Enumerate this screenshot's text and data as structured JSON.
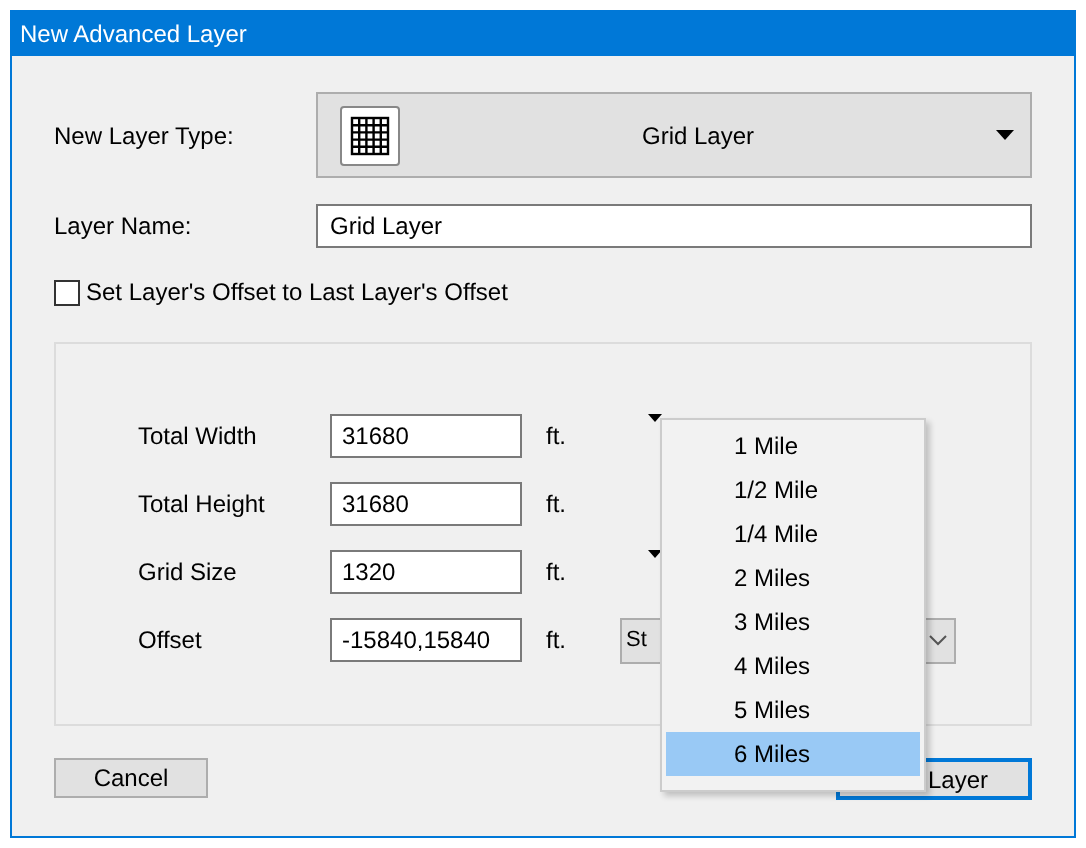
{
  "window": {
    "title": "New Advanced Layer"
  },
  "layer_type": {
    "label": "New Layer Type:",
    "value": "Grid Layer"
  },
  "layer_name": {
    "label": "Layer Name:",
    "value": "Grid Layer"
  },
  "offset_checkbox": {
    "label": "Set Layer's Offset to Last Layer's Offset",
    "checked": false
  },
  "rows": [
    {
      "label": "Total Width",
      "value": "31680",
      "unit": "ft.",
      "extra": {
        "kind": "arrow"
      }
    },
    {
      "label": "Total Height",
      "value": "31680",
      "unit": "ft."
    },
    {
      "label": "Grid Size",
      "value": "1320",
      "unit": "ft.",
      "extra": {
        "kind": "arrow"
      }
    },
    {
      "label": "Offset",
      "value": "-15840,15840",
      "unit": "ft.",
      "extra": {
        "kind": "combo",
        "text": "St"
      }
    }
  ],
  "buttons": {
    "cancel": "Cancel",
    "add": "Layer"
  },
  "size_menu": [
    {
      "label": "1 Mile",
      "selected": false
    },
    {
      "label": "1/2 Mile",
      "selected": false
    },
    {
      "label": "1/4 Mile",
      "selected": false
    },
    {
      "label": "2 Miles",
      "selected": false
    },
    {
      "label": "3 Miles",
      "selected": false
    },
    {
      "label": "4 Miles",
      "selected": false
    },
    {
      "label": "5 Miles",
      "selected": false
    },
    {
      "label": "6 Miles",
      "selected": true
    }
  ]
}
